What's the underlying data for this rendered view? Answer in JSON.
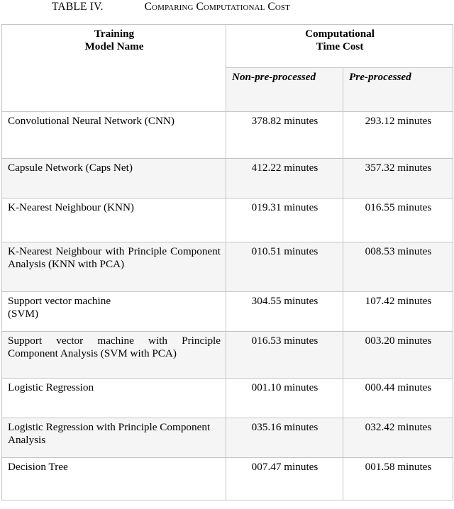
{
  "caption": {
    "number": "TABLE IV.",
    "title": "Comparing Computational Cost"
  },
  "table": {
    "headers": {
      "col1": "Training\nModel Name",
      "col1_line1": "Training",
      "col1_line2": "Model Name",
      "col2_group": "Computational\nTime Cost",
      "col2_group_line1": "Computational",
      "col2_group_line2": "Time Cost",
      "sub1": "Non-pre-processed",
      "sub2": "Pre-processed"
    },
    "rows": [
      {
        "model": "Convolutional Neural Network (CNN)",
        "non_preprocessed": "378.82 minutes",
        "preprocessed": "293.12 minutes"
      },
      {
        "model": "Capsule Network (Caps Net)",
        "non_preprocessed": "412.22 minutes",
        "preprocessed": "357.32 minutes"
      },
      {
        "model": "K-Nearest Neighbour (KNN)",
        "non_preprocessed": "019.31 minutes",
        "preprocessed": "016.55 minutes"
      },
      {
        "model": "K-Nearest Neighbour with Principle Component Analysis (KNN with PCA)",
        "non_preprocessed": "010.51 minutes",
        "preprocessed": "008.53 minutes"
      },
      {
        "model": "Support vector machine\n (SVM)",
        "non_preprocessed": "304.55 minutes",
        "preprocessed": "107.42 minutes"
      },
      {
        "model": "Support vector machine with Principle Component Analysis (SVM with PCA)",
        "non_preprocessed": "016.53 minutes",
        "preprocessed": "003.20 minutes"
      },
      {
        "model": "Logistic Regression",
        "non_preprocessed": "001.10 minutes",
        "preprocessed": "000.44 minutes"
      },
      {
        "model": "Logistic Regression with Principle Component Analysis",
        "non_preprocessed": "035.16 minutes",
        "preprocessed": "032.42 minutes"
      },
      {
        "model": "Decision Tree",
        "non_preprocessed": "007.47 minutes",
        "preprocessed": "001.58 minutes"
      }
    ]
  },
  "colors": {
    "page_background": "#ffffff",
    "text": "#000000",
    "row_shade": "#f5f5f5",
    "border": "#c4c4c4"
  }
}
